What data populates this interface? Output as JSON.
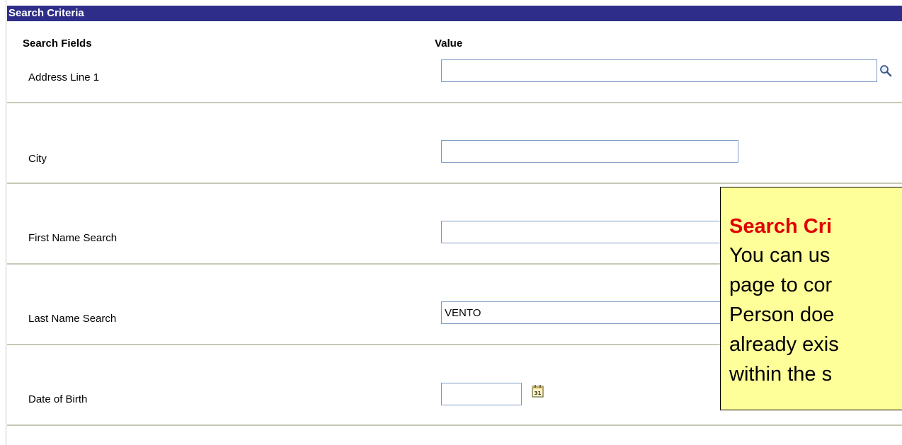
{
  "header": {
    "title": "Search Criteria"
  },
  "columns": {
    "fields": "Search Fields",
    "value": "Value"
  },
  "fields": [
    {
      "label": "Address Line 1",
      "value": ""
    },
    {
      "label": "City",
      "value": ""
    },
    {
      "label": "First Name Search",
      "value": ""
    },
    {
      "label": "Last Name Search",
      "value": "VENTO"
    },
    {
      "label": "Date of Birth",
      "value": ""
    }
  ],
  "callout": {
    "title": "Search Cri",
    "lines": [
      "You can us",
      "page to cor",
      "Person doe",
      "already exis",
      "within the s"
    ]
  },
  "icons": {
    "lookup": "magnifier-icon",
    "calendar": "calendar-icon"
  },
  "colors": {
    "header_bg": "#2e2e8a",
    "field_border": "#7e9cc4",
    "callout_bg": "#ffff99",
    "callout_title": "#e00000"
  }
}
